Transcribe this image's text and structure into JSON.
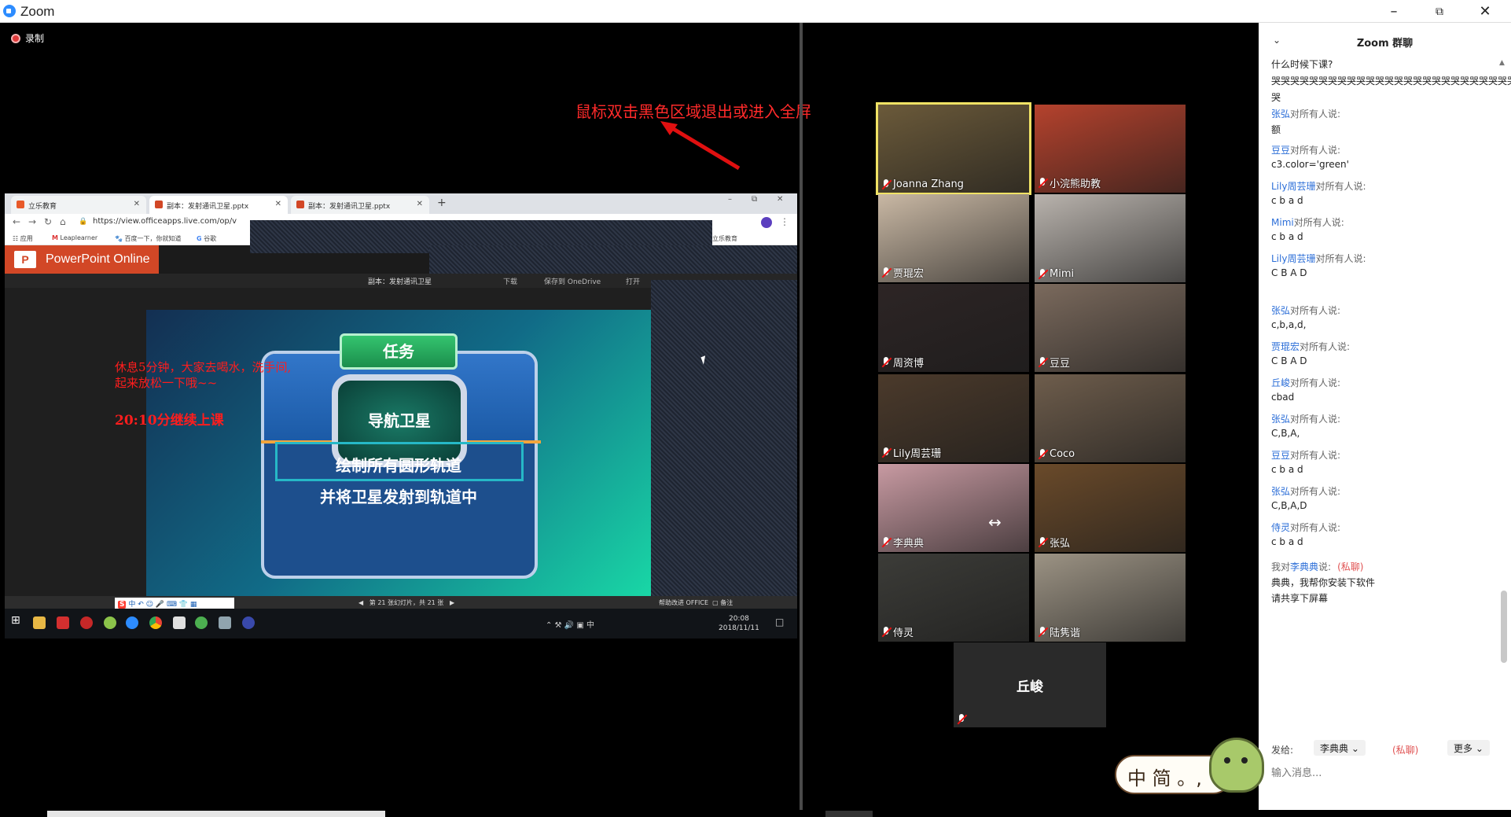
{
  "window": {
    "app_title": "Zoom",
    "min_icon": "minimize-icon",
    "max_icon": "restore-icon",
    "close_icon": "close-icon"
  },
  "recording": {
    "label": "录制"
  },
  "hint": {
    "text": "鼠标双击黑色区域退出或进入全屏"
  },
  "shared_screen": {
    "browser": {
      "tabs": [
        {
          "label": "立乐教育"
        },
        {
          "label": "副本：发射通讯卫星.pptx"
        },
        {
          "label": "副本：发射通讯卫星.pptx"
        }
      ],
      "url": "https://view.officeapps.live.com/op/v",
      "bookmarks": [
        "应用",
        "Leaplearner",
        "百度一下，你就知道",
        "谷歌",
        "立乐教育"
      ]
    },
    "ppt": {
      "app_name": "PowerPoint Online",
      "doc_title": "副本：发射通讯卫星",
      "download": "下载",
      "save_onedrive": "保存到 OneDrive",
      "open": "打开",
      "slide_task": "任务",
      "slide_screen": "导航卫星",
      "slide_line1": "绘制所有圆形轨道",
      "slide_line2": "并将卫星发射到轨道中",
      "note_line1": "休息5分钟，大家去喝水，洗手间,",
      "note_line2": "起来放松一下哦~~",
      "note_line3": "20:10分继续上课",
      "page_indicator": "第 21 张幻灯片，共 21 张",
      "help_improve": "帮助改进 OFFICE",
      "notes": "备注"
    },
    "taskbar": {
      "time": "20:08",
      "date": "2018/11/11",
      "ime": "中"
    },
    "ime_bar": {
      "logo": "S",
      "mode": "中"
    }
  },
  "participants": [
    {
      "name": "Joanna Zhang",
      "color": "#6b5a3a",
      "speaker": true
    },
    {
      "name": "小浣熊助教",
      "color": "#b5422d"
    },
    {
      "name": "贾琨宏",
      "color": "#c9b8a4"
    },
    {
      "name": "Mimi",
      "color": "#b9b3ad"
    },
    {
      "name": "周资博",
      "color": "#2d2525"
    },
    {
      "name": "豆豆",
      "color": "#7b6a5d"
    },
    {
      "name": "Lily周芸珊",
      "color": "#4b3a2b"
    },
    {
      "name": "Coco",
      "color": "#6e5d4c"
    },
    {
      "name": "李典典",
      "color": "#c89aa2"
    },
    {
      "name": "张弘",
      "color": "#6a4a2a"
    },
    {
      "name": "侍灵",
      "color": "#3c3c38"
    },
    {
      "name": "陆隽谐",
      "color": "#9c9384"
    }
  ],
  "no_video_participant": {
    "name": "丘峻"
  },
  "chat": {
    "title": "Zoom 群聊",
    "to_everyone": "对所有人说:",
    "messages": [
      {
        "sender": "",
        "text": "什么时候下课?"
      },
      {
        "sender": "",
        "text": "哭哭哭哭哭哭哭哭哭哭哭哭哭哭哭哭哭哭哭哭哭哭哭哭哭哭"
      },
      {
        "sender": "",
        "text": "哭"
      },
      {
        "sender": "张弘",
        "text": "额"
      },
      {
        "sender": "豆豆",
        "text": "c3.color='green'"
      },
      {
        "sender": "Lily周芸珊",
        "text": "c b a d"
      },
      {
        "sender": "Mimi",
        "text": " c b a d"
      },
      {
        "sender": "Lily周芸珊",
        "text": "C B A D"
      },
      {
        "sender": "张弘",
        "text": "c,b,a,d,"
      },
      {
        "sender": "贾琨宏",
        "text": "C B A D"
      },
      {
        "sender": "丘峻",
        "text": "cbad"
      },
      {
        "sender": "张弘",
        "text": "C,B,A,"
      },
      {
        "sender": "豆豆",
        "text": "c b a d"
      },
      {
        "sender": "张弘",
        "text": "C,B,A,D"
      },
      {
        "sender": "侍灵",
        "text": "c  b  a  d"
      }
    ],
    "private_msg": {
      "prefix": "我对",
      "target": "李典典",
      "suffix": "说:",
      "tag": "(私聊)",
      "line1": "典典，我帮你安装下软件",
      "line2": "请共享下屏幕"
    },
    "send_to_label": "发给:",
    "send_to_value": "李典典",
    "private_tag": "(私聊)",
    "more_label": "更多",
    "input_placeholder": "输入消息..."
  },
  "ime_float": {
    "text": "中 简 。,"
  }
}
